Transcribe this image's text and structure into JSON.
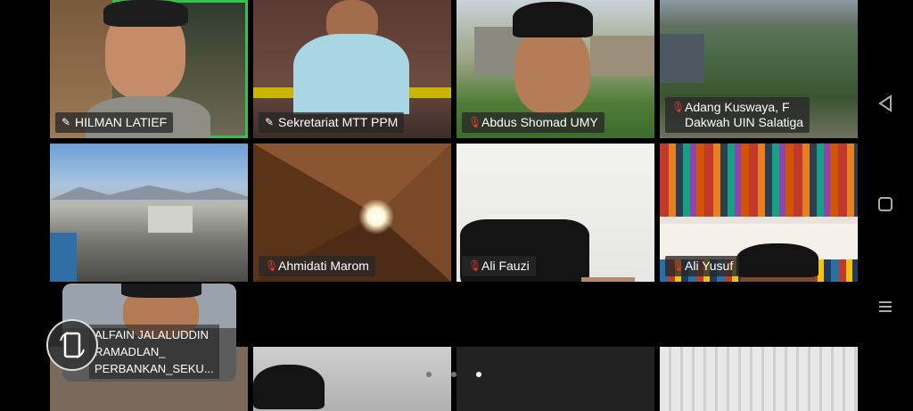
{
  "participants": [
    {
      "name": "HILMAN LATIEF",
      "icon": "pin-icon",
      "active": true
    },
    {
      "name": "Sekretariat MTT PPM",
      "icon": "pin-icon"
    },
    {
      "name": "Abdus Shomad UMY",
      "icon": "mic-off-icon"
    },
    {
      "name": "Adang Kuswaya, F\nDakwah UIN Salatiga",
      "line1": "Adang Kuswaya, F",
      "line2": "Dakwah UIN Salatiga",
      "icon": "mic-off-icon"
    },
    {
      "name": "",
      "icon": ""
    },
    {
      "name": "Ahmidati Marom",
      "icon": "mic-off-icon"
    },
    {
      "name": "Ali Fauzi",
      "icon": "mic-off-icon"
    },
    {
      "name": "Ali Yusuf",
      "icon": "mic-off-icon"
    }
  ],
  "pip": {
    "line1": "ALFAIN JALALUDDIN",
    "line2": "RAMADLAN_",
    "line3": "PERBANKAN_SEKU..."
  },
  "pagination": {
    "pages": 3,
    "current": 3
  },
  "colors": {
    "active_border": "#35c24a",
    "muted_mic": "#e53935"
  },
  "system_nav": [
    "back-icon",
    "home-icon",
    "recents-icon"
  ]
}
